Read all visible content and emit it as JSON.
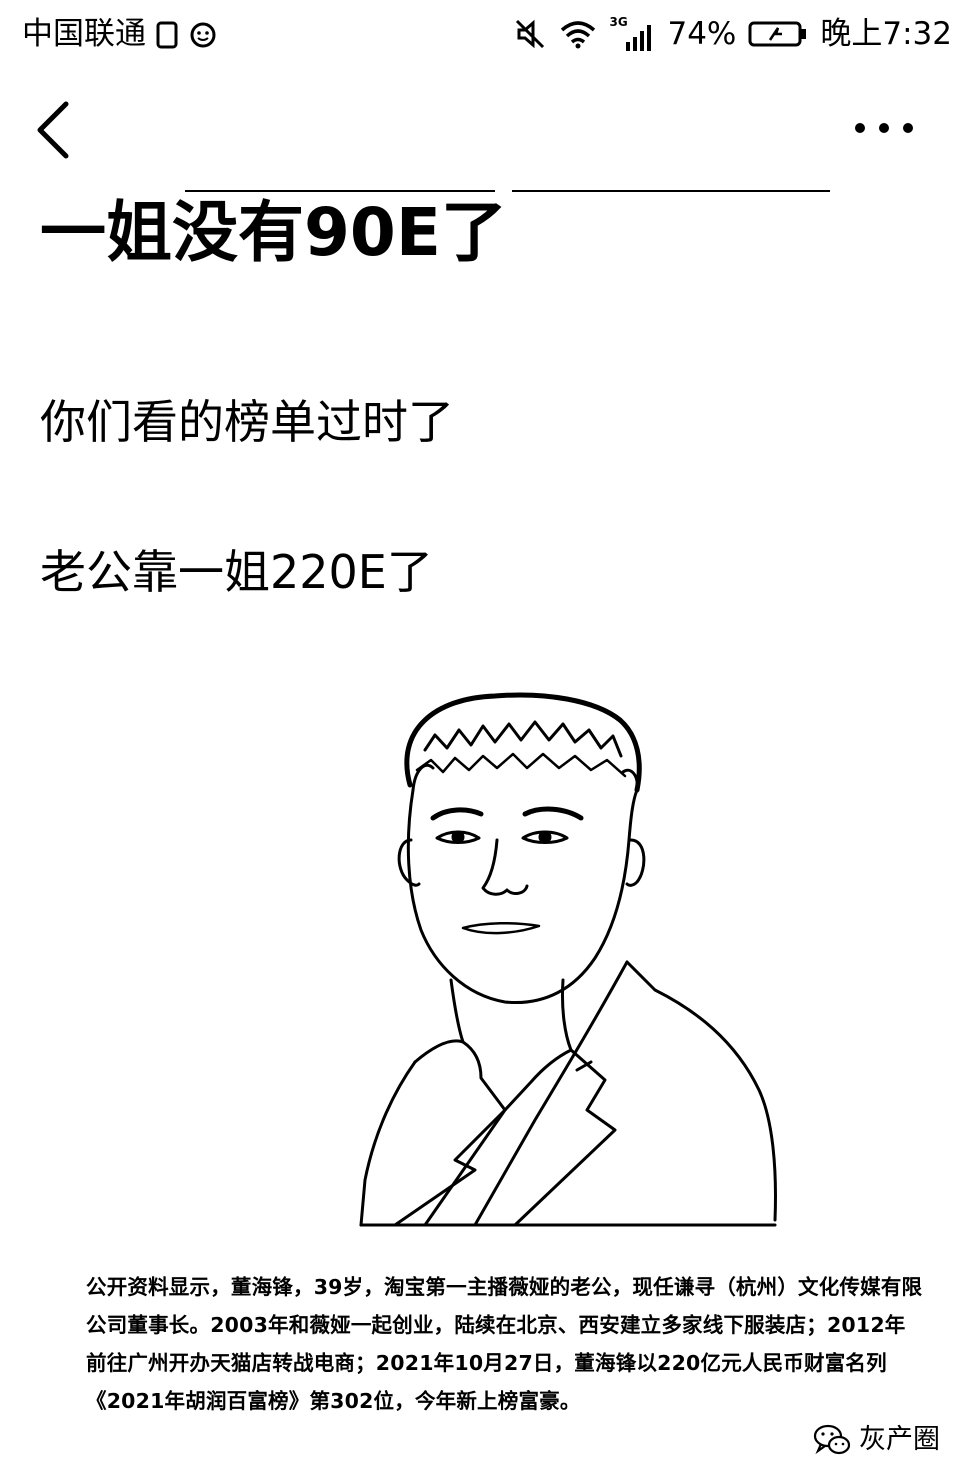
{
  "status_bar": {
    "carrier": "中国联通",
    "network": "3G",
    "battery": "74%",
    "time": "晚上7:32",
    "icons": [
      "sim-icon",
      "notification-face-icon",
      "mute-icon",
      "wifi-icon",
      "signal-icon",
      "battery-icon"
    ]
  },
  "nav": {
    "back_icon": "chevron-left-icon",
    "more_icon": "more-dots-icon"
  },
  "post": {
    "headline": "一姐没有90E了",
    "line1": "你们看的榜单过时了",
    "line2": "老公靠一姐220E了",
    "image": "portrait-illustration",
    "caption": "公开资料显示，董海锋，39岁，淘宝第一主播薇娅的老公，现任谦寻（杭州）文化传媒有限公司董事长。2003年和薇娅一起创业，陆续在北京、西安建立多家线下服装店；2012年前往广州开办天猫店转战电商；2021年10月27日，董海锋以220亿元人民币财富名列《2021年胡润百富榜》第302位，今年新上榜富豪。"
  },
  "watermark": {
    "icon": "wechat-icon",
    "text": "灰产圈"
  }
}
